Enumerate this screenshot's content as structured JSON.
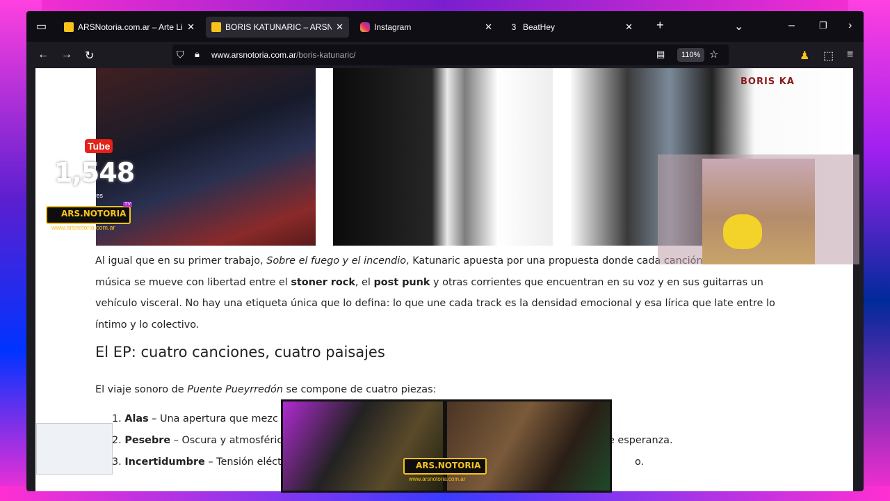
{
  "browser": {
    "tabs": [
      {
        "title": "ARSNotoria.com.ar – Arte Libre",
        "favicon": "ars-favicon",
        "active": false
      },
      {
        "title": "BORIS KATUNARIC – ARSNotori",
        "favicon": "ars-favicon",
        "active": true
      },
      {
        "title": "Instagram",
        "favicon": "instagram-favicon",
        "active": false
      },
      {
        "title": "BeatHey",
        "favicon": "beathey-favicon",
        "active": false
      }
    ],
    "url_domain": "www.arsnotoria.com.ar",
    "url_path": "/boris-katunaric/",
    "zoom": "110%"
  },
  "overlay": {
    "youtube_label": "Tube",
    "subscriber_count": "1,548",
    "subscriber_label": "Suscriptores",
    "brand": "ARS.NOTORIA",
    "brand_badge": "TV",
    "brand_url": "www.arsnotoria.com.ar",
    "photo_text": "BORIS KA"
  },
  "article": {
    "para_part1": "Al igual que en su primer trabajo, ",
    "para_italic": "Sobre el fuego y el incendio",
    "para_part2": ", Katunaric apuesta por una propuesta donde cada canción es distinto. Su música se mueve con libertad entre el ",
    "para_bold1": "stoner rock",
    "para_part3": ", el ",
    "para_bold2": "post punk",
    "para_part4": " y otras corrientes que encuentran en su voz y en sus guitarras un vehículo visceral. No hay una etiqueta única que lo defina: lo que une cada track es la densidad emocional y esa lírica que late entre lo íntimo y lo colectivo.",
    "section_heading": "El EP: cuatro canciones, cuatro paisajes",
    "intro_part1": "El viaje sonoro de ",
    "intro_italic": "Puente Pueyrredón",
    "intro_part2": " se compone de cuatro piezas:",
    "tracks": [
      {
        "num": "1.",
        "name": "Alas",
        "desc": " – Una apertura que mezc"
      },
      {
        "num": "2.",
        "name": "Pesebre",
        "desc": " – Oscura y atmosféric",
        "tail": "e esperanza."
      },
      {
        "num": "3.",
        "name": "Incertidumbre",
        "desc": " – Tensión eléct",
        "tail": "o."
      }
    ]
  }
}
